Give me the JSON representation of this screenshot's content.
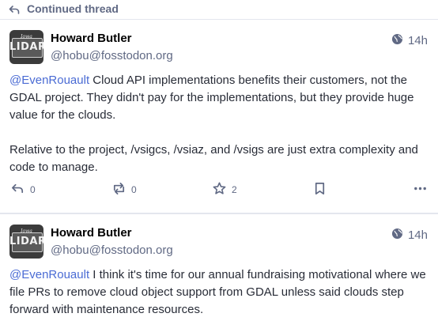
{
  "thread": {
    "label": "Continued thread"
  },
  "posts": [
    {
      "display_name": "Howard Butler",
      "acct": "@hobu@fosstodon.org",
      "time": "14h",
      "avatar": {
        "top_text": "Iowa",
        "main_text": "LIDAR"
      },
      "mention": "@EvenRouault",
      "paragraph1": " Cloud API implementations benefits their customers, not the GDAL project. They didn't pay for the implementations, but they provide huge value for the clouds.",
      "paragraph2": "Relative to the project, /vsigcs, /vsiaz, and /vsigs are just extra complexity and code to manage.",
      "replies": "0",
      "boosts": "0",
      "favourites": "2"
    },
    {
      "display_name": "Howard Butler",
      "acct": "@hobu@fosstodon.org",
      "time": "14h",
      "avatar": {
        "top_text": "Iowa",
        "main_text": "LIDAR"
      },
      "mention": "@EvenRouault",
      "paragraph1": " I think it's time for our annual fundraising motivational where we file PRs to remove cloud object support from GDAL unless said clouds step forward with maintenance resources."
    }
  ],
  "icons": {
    "thread": "reply-arrow-icon",
    "visibility": "globe-icon",
    "reply": "reply-icon",
    "boost": "boost-icon",
    "favourite": "star-icon",
    "bookmark": "bookmark-icon",
    "more": "more-icon"
  }
}
